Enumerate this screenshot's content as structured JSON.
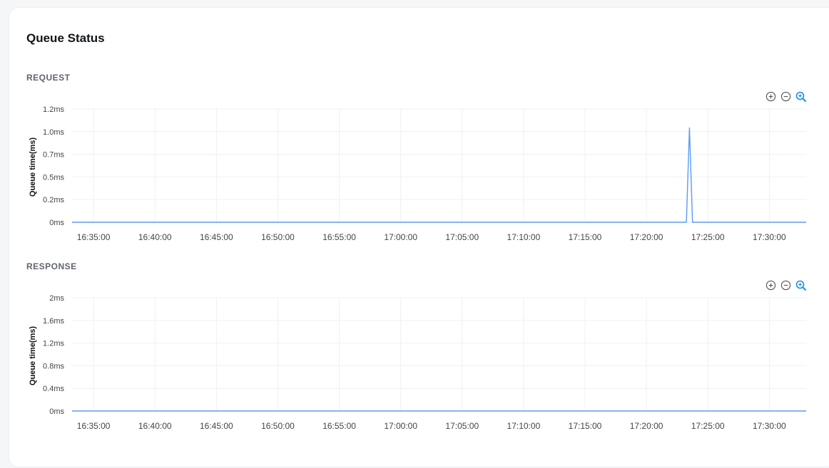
{
  "card": {
    "title": "Queue Status"
  },
  "colors": {
    "series": "#5b9bf0",
    "grid": "#eef0f4",
    "axis": "#444444",
    "zoom_active": "#1a8ce8",
    "zoom_icon": "#555555"
  },
  "toolbar_icons": [
    "zoom-in-icon",
    "zoom-out-icon",
    "zoom-reset-icon"
  ],
  "chart_data": [
    {
      "type": "line",
      "section": "REQUEST",
      "ylabel": "Queue time(ms)",
      "ytick_labels": [
        "0ms",
        "0.2ms",
        "0.5ms",
        "0.7ms",
        "1.0ms",
        "1.2ms"
      ],
      "ylim": [
        0,
        1.2
      ],
      "y_unit": "ms",
      "xlabel": "",
      "xtick_labels": [
        "16:35:00",
        "16:40:00",
        "16:45:00",
        "16:50:00",
        "16:55:00",
        "17:00:00",
        "17:05:00",
        "17:10:00",
        "17:15:00",
        "17:20:00",
        "17:25:00",
        "17:30:00"
      ],
      "xlim": [
        "16:33:15",
        "17:33:00"
      ],
      "grid": true,
      "legend": "none",
      "series": [
        {
          "x": [
            "16:33:15",
            "17:23:15",
            "17:23:30",
            "17:23:45",
            "17:33:00"
          ],
          "y": [
            0,
            0,
            1.0,
            0,
            0
          ]
        }
      ]
    },
    {
      "type": "line",
      "section": "RESPONSE",
      "ylabel": "Queue time(ms)",
      "ytick_labels": [
        "0ms",
        "0.4ms",
        "0.8ms",
        "1.2ms",
        "1.6ms",
        "2ms"
      ],
      "ylim": [
        0,
        2
      ],
      "y_unit": "ms",
      "xlabel": "",
      "xtick_labels": [
        "16:35:00",
        "16:40:00",
        "16:45:00",
        "16:50:00",
        "16:55:00",
        "17:00:00",
        "17:05:00",
        "17:10:00",
        "17:15:00",
        "17:20:00",
        "17:25:00",
        "17:30:00"
      ],
      "xlim": [
        "16:33:15",
        "17:33:00"
      ],
      "grid": true,
      "legend": "none",
      "series": [
        {
          "x": [
            "16:33:15",
            "17:33:00"
          ],
          "y": [
            0,
            0
          ]
        }
      ]
    }
  ]
}
